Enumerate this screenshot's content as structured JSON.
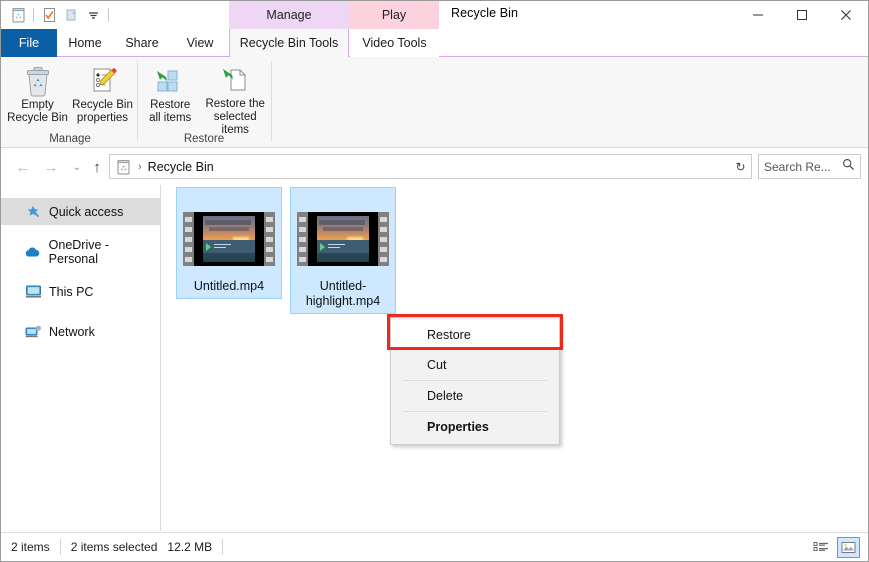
{
  "window": {
    "title": "Recycle Bin",
    "quick_access_toolbar": [
      {
        "name": "recycle-bin-icon",
        "label": "Recycle Bin"
      },
      {
        "name": "properties-icon",
        "label": "Recycle Bin properties"
      },
      {
        "name": "new-folder-icon",
        "label": "New folder"
      },
      {
        "name": "customize-qat-icon",
        "label": "Customize Quick Access Toolbar"
      }
    ],
    "controls": {
      "minimize": "—",
      "maximize": "☐",
      "close": "✕"
    }
  },
  "contextual_tabs": [
    {
      "label": "Manage",
      "color": "#eed7f5"
    },
    {
      "label": "Play",
      "color": "#fbd2de"
    }
  ],
  "tabs": [
    {
      "label": "File",
      "active": false
    },
    {
      "label": "Home",
      "active": false
    },
    {
      "label": "Share",
      "active": false
    },
    {
      "label": "View",
      "active": false
    },
    {
      "label": "Recycle Bin Tools",
      "active": true
    },
    {
      "label": "Video Tools",
      "active": false
    }
  ],
  "ribbon": {
    "collapse_label": "^",
    "help_label": "?",
    "groups": [
      {
        "title": "Manage",
        "buttons": [
          {
            "label": "Empty\nRecycle Bin",
            "line1": "Empty",
            "line2": "Recycle Bin",
            "icon": "empty-recycle-bin-icon"
          },
          {
            "label": "Recycle Bin\nproperties",
            "line1": "Recycle Bin",
            "line2": "properties",
            "icon": "recycle-bin-properties-icon"
          }
        ]
      },
      {
        "title": "Restore",
        "buttons": [
          {
            "label": "Restore\nall items",
            "line1": "Restore",
            "line2": "all items",
            "icon": "restore-all-items-icon"
          },
          {
            "label": "Restore the\nselected items",
            "line1": "Restore the",
            "line2": "selected items",
            "icon": "restore-selected-items-icon"
          }
        ]
      }
    ]
  },
  "address_bar": {
    "back_label": "←",
    "forward_label": "→",
    "history_label": "⌄",
    "up_label": "↑",
    "breadcrumb_icon": "recycle-bin-icon",
    "breadcrumb_separator": "›",
    "breadcrumb_text": "Recycle Bin",
    "dropdown_label": "⌄",
    "refresh_label": "↻"
  },
  "search": {
    "placeholder": "Search Re...",
    "icon": "search-icon"
  },
  "sidebar": {
    "items": [
      {
        "label": "Quick access",
        "icon": "pin-star-icon",
        "selected": true
      },
      {
        "label": "OneDrive - Personal",
        "icon": "cloud-icon",
        "selected": false
      },
      {
        "label": "This PC",
        "icon": "monitor-icon",
        "selected": false
      },
      {
        "label": "Network",
        "icon": "network-icon",
        "selected": false
      }
    ]
  },
  "files": [
    {
      "name": "Untitled.mp4",
      "selected": true,
      "icon": "video-thumbnail"
    },
    {
      "name": "Untitled-highlight.mp4",
      "selected": true,
      "icon": "video-thumbnail"
    }
  ],
  "context_menu": {
    "highlight_color": "#ee2a1e",
    "items": [
      {
        "label": "Restore",
        "bold": false,
        "highlighted": true,
        "separator_after": false
      },
      {
        "label": "Cut",
        "bold": false,
        "highlighted": false,
        "separator_after": true
      },
      {
        "label": "Delete",
        "bold": false,
        "highlighted": false,
        "separator_after": true
      },
      {
        "label": "Properties",
        "bold": true,
        "highlighted": false,
        "separator_after": false
      }
    ]
  },
  "status_bar": {
    "item_count": "2 items",
    "selection_count": "2 items selected",
    "selection_size": "12.2 MB",
    "view_buttons": [
      {
        "name": "details-view-button",
        "active": false
      },
      {
        "name": "large-icons-view-button",
        "active": true
      }
    ]
  }
}
